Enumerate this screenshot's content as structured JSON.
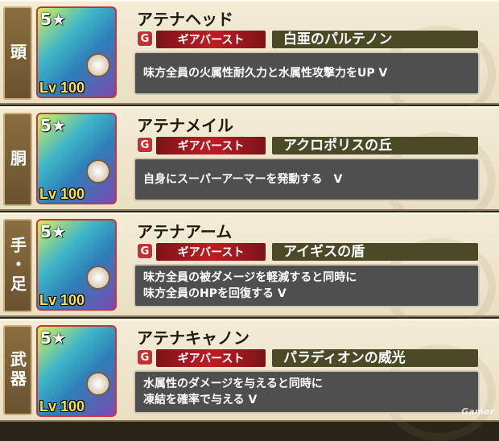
{
  "items": [
    {
      "slot": "頭",
      "stars": "5",
      "level": "Lv 100",
      "name": "アテナヘッド",
      "type": "ギアバースト",
      "skill": "白亜のパルテノン",
      "desc": [
        "味方全員の火属性耐久力と水属性攻撃力をUP V"
      ]
    },
    {
      "slot": "胴",
      "stars": "5",
      "level": "Lv 100",
      "name": "アテナメイル",
      "type": "ギアバースト",
      "skill": "アクロポリスの丘",
      "desc": [
        "自身にスーパーアーマーを発動する　V"
      ]
    },
    {
      "slot": "手・足",
      "stars": "5",
      "level": "Lv 100",
      "name": "アテナアーム",
      "type": "ギアバースト",
      "skill": "アイギスの盾",
      "desc": [
        "味方全員の被ダメージを軽減すると同時に",
        "味方全員のHPを回復する V"
      ]
    },
    {
      "slot": "武器",
      "stars": "5",
      "level": "Lv 100",
      "name": "アテナキャノン",
      "type": "ギアバースト",
      "skill": "パラディオンの威光",
      "desc": [
        "水属性のダメージを与えると同時に",
        "凍結を確率で与える V"
      ]
    }
  ],
  "g_icon": "G",
  "watermark": "Gamer"
}
